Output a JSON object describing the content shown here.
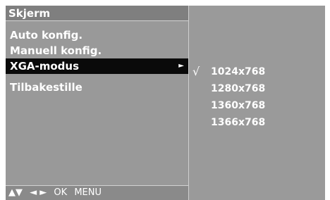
{
  "menu": {
    "title": "Skjerm",
    "items": [
      {
        "label": "Auto konfig."
      },
      {
        "label": "Manuell konfig."
      },
      {
        "label": "XGA-modus",
        "arrow": "►"
      },
      {
        "label": "Tilbakestille"
      }
    ],
    "selected_item": "XGA-modus"
  },
  "submenu": {
    "check_mark": "√",
    "options": [
      "1024x768",
      "1280x768",
      "1360x768",
      "1366x768"
    ],
    "selected_option": "1024x768"
  },
  "bottom_bar": {
    "nav_up_down": "▲▼",
    "nav_left_right": "◄ ►",
    "ok_label": "OK",
    "menu_label": "MENU"
  },
  "colors": {
    "panel_background": "#999999",
    "title_background": "#7f7f7f",
    "highlight_background": "#0a0a0a",
    "text": "#ffffff"
  }
}
